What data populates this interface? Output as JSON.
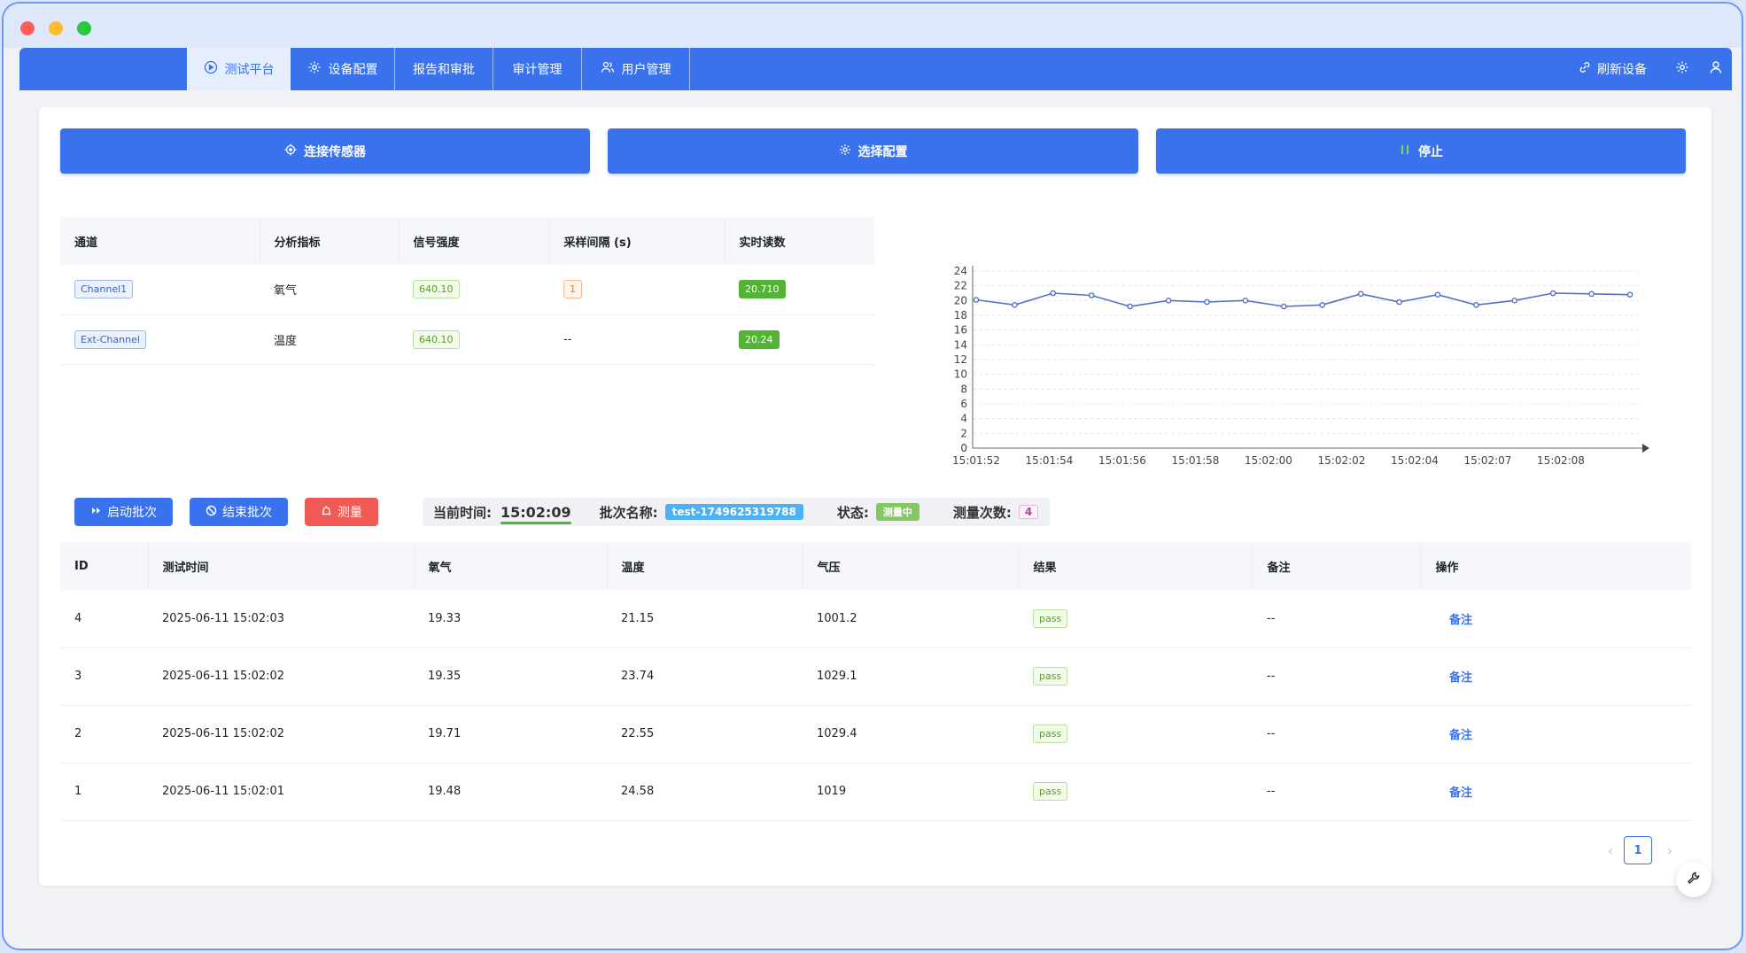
{
  "nav": {
    "tabs": [
      {
        "label": "测试平台",
        "icon": "play-circle-icon",
        "active": true
      },
      {
        "label": "设备配置",
        "icon": "gear-icon"
      },
      {
        "label": "报告和审批",
        "icon": ""
      },
      {
        "label": "审计管理",
        "icon": ""
      },
      {
        "label": "用户管理",
        "icon": "users-icon"
      }
    ],
    "refresh_label": "刷新设备"
  },
  "actions": {
    "connect_label": "连接传感器",
    "config_label": "选择配置",
    "stop_label": "停止"
  },
  "channels": {
    "headers": [
      "通道",
      "分析指标",
      "信号强度",
      "采样间隔 (s)",
      "实时读数"
    ],
    "rows": [
      {
        "channel": "Channel1",
        "metric": "氧气",
        "signal": "640.10",
        "interval": "1",
        "reading": "20.710"
      },
      {
        "channel": "Ext-Channel",
        "metric": "温度",
        "signal": "640.10",
        "interval": "--",
        "reading": "20.24"
      }
    ]
  },
  "chart_data": {
    "type": "line",
    "x_labels": [
      "15:01:52",
      "15:01:54",
      "15:01:56",
      "15:01:58",
      "15:02:00",
      "15:02:02",
      "15:02:04",
      "15:02:07",
      "15:02:08"
    ],
    "values": [
      20.1,
      19.4,
      21.0,
      20.7,
      19.2,
      20.0,
      19.8,
      20.0,
      19.2,
      19.4,
      20.9,
      19.8,
      20.8,
      19.4,
      20.0,
      21.0,
      20.9,
      20.8
    ],
    "ylim": [
      0,
      24
    ],
    "yticks": [
      0,
      2,
      4,
      6,
      8,
      10,
      12,
      14,
      16,
      18,
      20,
      22,
      24
    ],
    "color": "#5470c6",
    "grid": true
  },
  "batch": {
    "start_label": "启动批次",
    "end_label": "结束批次",
    "measure_label": "测量",
    "time_label": "当前时间:",
    "time_value": "15:02:09",
    "name_label": "批次名称:",
    "name_value": "test-1749625319788",
    "status_label": "状态:",
    "status_value": "测量中",
    "count_label": "测量次数:",
    "count_value": "4"
  },
  "results": {
    "headers": [
      "ID",
      "测试时间",
      "氧气",
      "温度",
      "气压",
      "结果",
      "备注",
      "操作"
    ],
    "rows": [
      {
        "id": "4",
        "time": "2025-06-11 15:02:03",
        "oxygen": "19.33",
        "temp": "21.15",
        "pressure": "1001.2",
        "result": "pass",
        "note": "--",
        "action": "备注"
      },
      {
        "id": "3",
        "time": "2025-06-11 15:02:02",
        "oxygen": "19.35",
        "temp": "23.74",
        "pressure": "1029.1",
        "result": "pass",
        "note": "--",
        "action": "备注"
      },
      {
        "id": "2",
        "time": "2025-06-11 15:02:02",
        "oxygen": "19.71",
        "temp": "22.55",
        "pressure": "1029.4",
        "result": "pass",
        "note": "--",
        "action": "备注"
      },
      {
        "id": "1",
        "time": "2025-06-11 15:02:01",
        "oxygen": "19.48",
        "temp": "24.58",
        "pressure": "1019",
        "result": "pass",
        "note": "--",
        "action": "备注"
      }
    ]
  },
  "pagination": {
    "current": "1"
  },
  "colors": {
    "primary": "#3a72ee",
    "danger": "#ef5a54",
    "success": "#52b335"
  }
}
